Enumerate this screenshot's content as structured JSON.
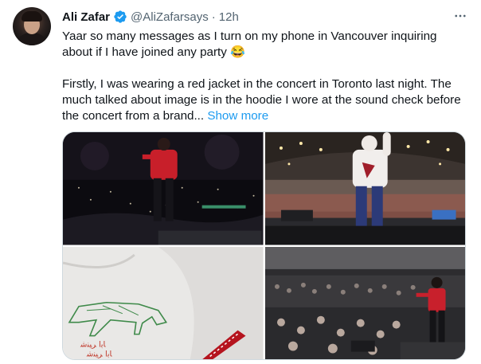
{
  "tweet": {
    "author": {
      "name": "Ali Zafar",
      "handle": "@AliZafarsays",
      "separator": "·",
      "time": "12h"
    },
    "text_p1": "Yaar so many messages as I turn on my phone in Vancouver inquiring about if I have joined any party 😂",
    "text_p2": "Firstly, I was wearing a red jacket in the concert in Toronto last night. The much talked about image is in the hoodie I wore at the sound check before the concert from a brand...",
    "show_more": "Show more",
    "media": [
      {
        "description": "concert-red-jacket-photo"
      },
      {
        "description": "soundcheck-white-hoodie-photo"
      },
      {
        "description": "hoodie-print-closeup-photo"
      },
      {
        "description": "arena-crowd-red-jacket-photo"
      }
    ]
  },
  "colors": {
    "verified": "#1d9bf0",
    "link": "#1d9bf0",
    "secondary_text": "#536471",
    "border": "#cfd9de"
  },
  "icons": {
    "verified": "verified-badge-icon",
    "more": "more-options-icon"
  }
}
